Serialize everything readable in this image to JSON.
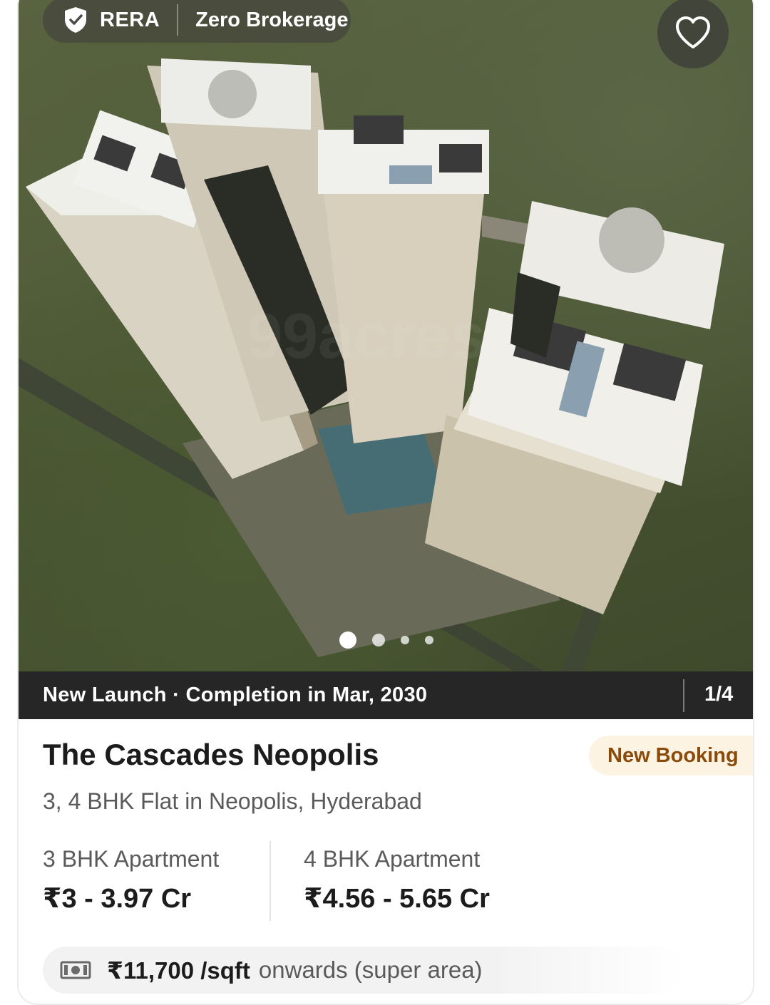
{
  "badges": {
    "rera": "RERA",
    "zero_brokerage": "Zero Brokerage"
  },
  "gallery": {
    "status": "New Launch · Completion in Mar, 2030",
    "counter": "1/4",
    "dots": 4,
    "active_dot": 1
  },
  "project": {
    "name": "The Cascades Neopolis",
    "tag": "New Booking",
    "subtitle": "3, 4 BHK Flat in Neopolis, Hyderabad"
  },
  "configs": [
    {
      "label": "3 BHK Apartment",
      "price": "₹3 - 3.97 Cr"
    },
    {
      "label": "4 BHK Apartment",
      "price": "₹4.56 - 5.65 Cr"
    }
  ],
  "rate": {
    "value": "₹11,700 /sqft",
    "suffix": "onwards (super area)"
  },
  "colors": {
    "tag_bg": "#fdf3e2",
    "tag_text": "#8a4a0a",
    "strip_bg": "#262626"
  },
  "icons": [
    "shield-check-icon",
    "heart-icon",
    "money-icon"
  ]
}
